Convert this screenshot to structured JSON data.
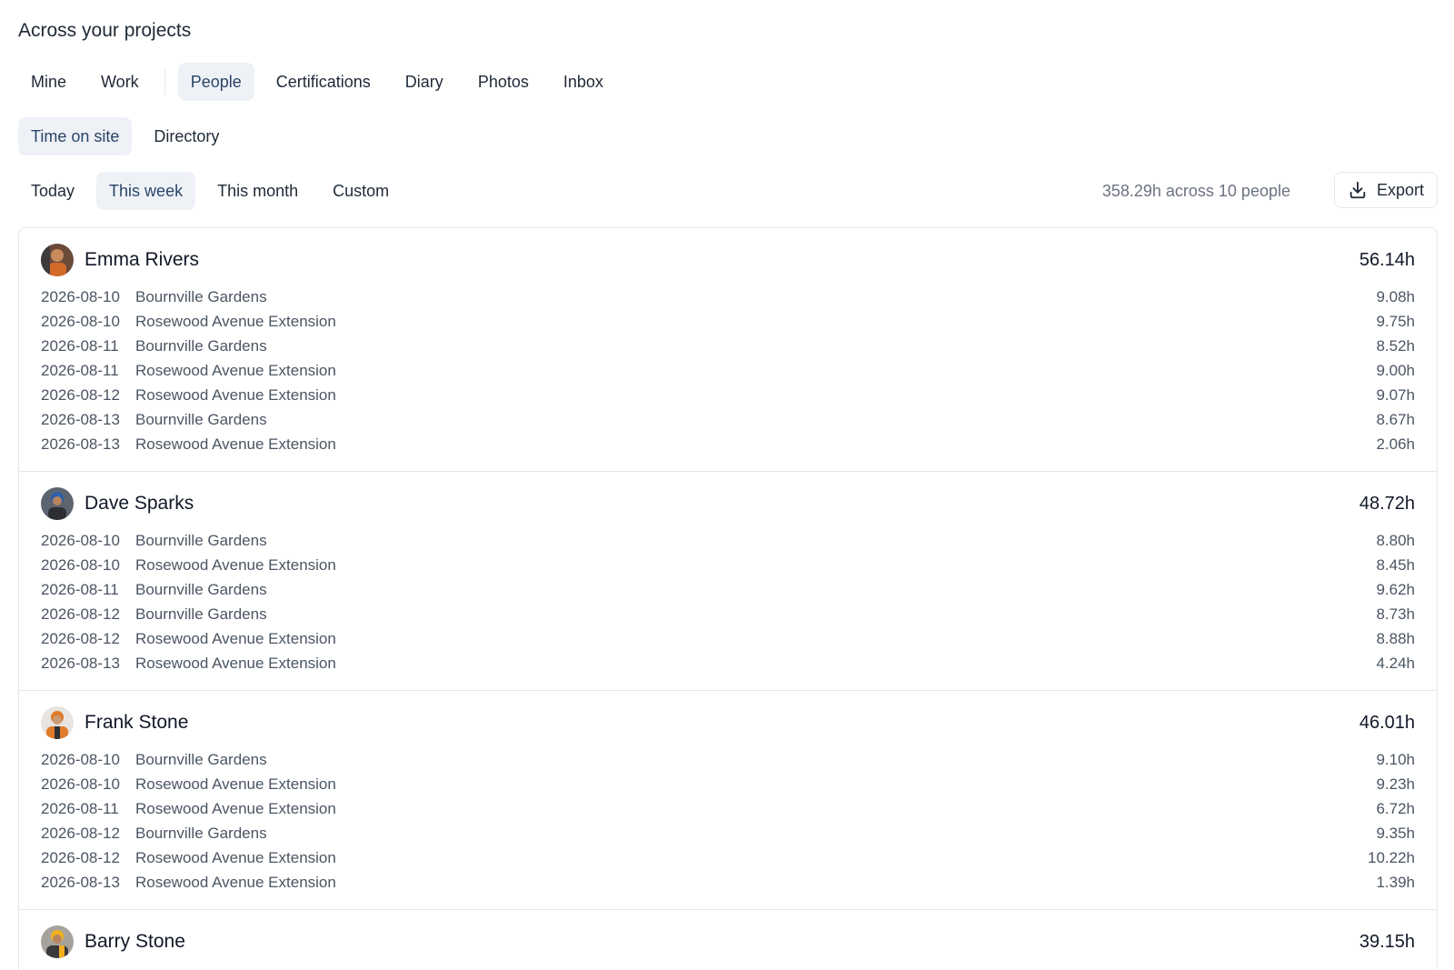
{
  "header": {
    "title": "Across your projects"
  },
  "main_tabs": [
    {
      "label": "Mine",
      "active": false
    },
    {
      "label": "Work",
      "active": false
    },
    {
      "label": "People",
      "active": true
    },
    {
      "label": "Certifications",
      "active": false
    },
    {
      "label": "Diary",
      "active": false
    },
    {
      "label": "Photos",
      "active": false
    },
    {
      "label": "Inbox",
      "active": false
    }
  ],
  "sub_tabs": [
    {
      "label": "Time on site",
      "active": true
    },
    {
      "label": "Directory",
      "active": false
    }
  ],
  "period_tabs": [
    {
      "label": "Today",
      "active": false
    },
    {
      "label": "This week",
      "active": true
    },
    {
      "label": "This month",
      "active": false
    },
    {
      "label": "Custom",
      "active": false
    }
  ],
  "summary": "358.29h across 10 people",
  "export": {
    "label": "Export",
    "icon": "download-icon"
  },
  "colors": {
    "accent_bg": "#eef2f7",
    "accent_text": "#2a4466",
    "muted": "#6b7280",
    "border": "#e5e7eb"
  },
  "people": [
    {
      "name": "Emma Rivers",
      "total": "56.14h",
      "entries": [
        {
          "date": "2026-08-10",
          "project": "Bournville Gardens",
          "hours": "9.08h"
        },
        {
          "date": "2026-08-10",
          "project": "Rosewood Avenue Extension",
          "hours": "9.75h"
        },
        {
          "date": "2026-08-11",
          "project": "Bournville Gardens",
          "hours": "8.52h"
        },
        {
          "date": "2026-08-11",
          "project": "Rosewood Avenue Extension",
          "hours": "9.00h"
        },
        {
          "date": "2026-08-12",
          "project": "Rosewood Avenue Extension",
          "hours": "9.07h"
        },
        {
          "date": "2026-08-13",
          "project": "Bournville Gardens",
          "hours": "8.67h"
        },
        {
          "date": "2026-08-13",
          "project": "Rosewood Avenue Extension",
          "hours": "2.06h"
        }
      ]
    },
    {
      "name": "Dave Sparks",
      "total": "48.72h",
      "entries": [
        {
          "date": "2026-08-10",
          "project": "Bournville Gardens",
          "hours": "8.80h"
        },
        {
          "date": "2026-08-10",
          "project": "Rosewood Avenue Extension",
          "hours": "8.45h"
        },
        {
          "date": "2026-08-11",
          "project": "Bournville Gardens",
          "hours": "9.62h"
        },
        {
          "date": "2026-08-12",
          "project": "Bournville Gardens",
          "hours": "8.73h"
        },
        {
          "date": "2026-08-12",
          "project": "Rosewood Avenue Extension",
          "hours": "8.88h"
        },
        {
          "date": "2026-08-13",
          "project": "Rosewood Avenue Extension",
          "hours": "4.24h"
        }
      ]
    },
    {
      "name": "Frank Stone",
      "total": "46.01h",
      "entries": [
        {
          "date": "2026-08-10",
          "project": "Bournville Gardens",
          "hours": "9.10h"
        },
        {
          "date": "2026-08-10",
          "project": "Rosewood Avenue Extension",
          "hours": "9.23h"
        },
        {
          "date": "2026-08-11",
          "project": "Rosewood Avenue Extension",
          "hours": "6.72h"
        },
        {
          "date": "2026-08-12",
          "project": "Bournville Gardens",
          "hours": "9.35h"
        },
        {
          "date": "2026-08-12",
          "project": "Rosewood Avenue Extension",
          "hours": "10.22h"
        },
        {
          "date": "2026-08-13",
          "project": "Rosewood Avenue Extension",
          "hours": "1.39h"
        }
      ]
    },
    {
      "name": "Barry Stone",
      "total": "39.15h",
      "entries": []
    }
  ]
}
